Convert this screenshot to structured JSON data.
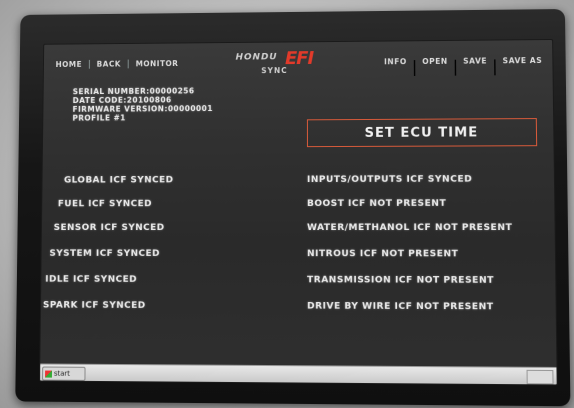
{
  "nav": {
    "home": "HOME",
    "back": "BACK",
    "monitor": "MONITOR",
    "sep": "|",
    "info": "INFO",
    "open": "OPEN",
    "save": "SAVE",
    "save_as": "SAVE AS"
  },
  "logo": {
    "brand": "HONDU",
    "efi": "EFI",
    "sync": "SYNC"
  },
  "device": {
    "serial": "SERIAL NUMBER:00000256",
    "date_code": "DATE CODE:20100806",
    "firmware": "FIRMWARE VERSION:00000001",
    "profile": "PROFILE #1"
  },
  "set_ecu_time": "SET ECU TIME",
  "left_status": [
    "GLOBAL ICF SYNCED",
    "FUEL ICF SYNCED",
    "SENSOR ICF SYNCED",
    "SYSTEM ICF SYNCED",
    "IDLE ICF SYNCED",
    "SPARK ICF SYNCED"
  ],
  "right_status": [
    "INPUTS/OUTPUTS ICF SYNCED",
    "BOOST ICF NOT PRESENT",
    "WATER/METHANOL ICF NOT PRESENT",
    "NITROUS ICF NOT PRESENT",
    "TRANSMISSION ICF NOT PRESENT",
    "DRIVE BY WIRE ICF NOT PRESENT"
  ],
  "taskbar": {
    "start": "start"
  },
  "colors": {
    "accent_red": "#e33a2a",
    "button_border": "#d75a3a"
  }
}
